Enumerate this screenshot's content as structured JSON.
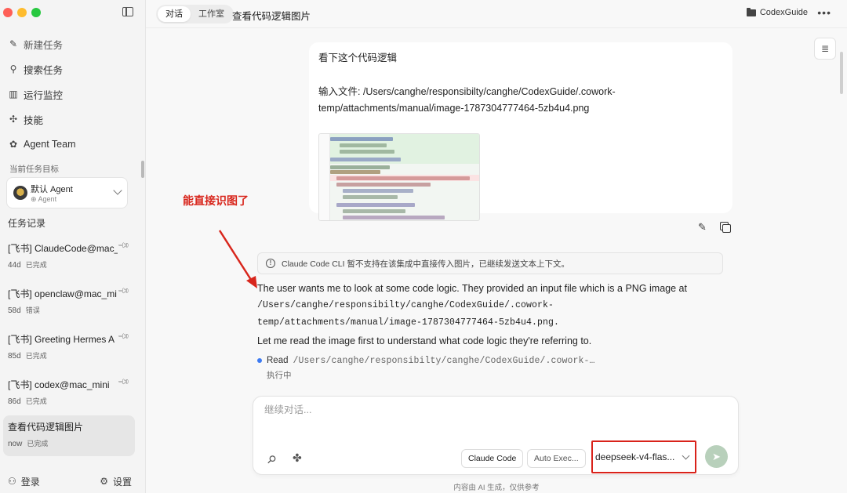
{
  "sidebar": {
    "nav": [
      {
        "label": "新建任务",
        "icon": "new-task-icon"
      },
      {
        "label": "搜索任务",
        "icon": "search-icon"
      },
      {
        "label": "运行监控",
        "icon": "bar-chart-icon"
      },
      {
        "label": "技能",
        "icon": "puzzle-icon"
      },
      {
        "label": "Agent Team",
        "icon": "team-icon"
      }
    ],
    "current_goal_label": "当前任务目标",
    "agent": {
      "name": "默认 Agent",
      "sub": "Agent"
    },
    "tasks_label": "任务记录",
    "tasks": [
      {
        "title": "[飞书] ClaudeCode@mac_",
        "age": "44d",
        "status": "已完成",
        "pinned": true
      },
      {
        "title": "[飞书] openclaw@mac_mi",
        "age": "58d",
        "status": "错误",
        "pinned": true
      },
      {
        "title": "[飞书] Greeting Hermes A",
        "age": "85d",
        "status": "已完成",
        "pinned": true
      },
      {
        "title": "[飞书] codex@mac_mini",
        "age": "86d",
        "status": "已完成",
        "pinned": true
      },
      {
        "title": "查看代码逻辑图片",
        "age": "now",
        "status": "已完成",
        "pinned": false
      }
    ],
    "footer": {
      "login": "登录",
      "settings": "设置"
    }
  },
  "topbar": {
    "tabs": [
      "对话",
      "工作室"
    ],
    "active_tab": "对话",
    "title": "查看代码逻辑图片",
    "project": "CodexGuide",
    "more": "•••"
  },
  "conversation": {
    "user_message": {
      "line1": "看下这个代码逻辑",
      "line2": "输入文件: /Users/canghe/responsibilty/canghe/CodexGuide/.cowork-temp/attachments/manual/image-1787304777464-5zb4u4.png"
    },
    "annotation": "能直接识图了",
    "notice": "Claude Code CLI 暂不支持在该集成中直接传入图片，已继续发送文本上下文。",
    "assistant": {
      "p1_text": "The user wants me to look at some code logic. They provided an input file which is a PNG image at",
      "p1_path": "/Users/canghe/responsibilty/canghe/CodexGuide/.cowork-temp/attachments/manual/image-1787304777464-5zb4u4.png.",
      "p2": "Let me read the image first to understand what code logic they're referring to."
    },
    "tool": {
      "name": "Read",
      "path": "/Users/canghe/responsibilty/canghe/CodexGuide/.cowork-…",
      "status": "执行中"
    }
  },
  "composer": {
    "placeholder": "继续对话...",
    "chip_claude": "Claude Code",
    "chip_auto": "Auto Exec...",
    "model": "deepseek-v4-flas...",
    "send": "➤"
  },
  "footer_note": "内容由 AI 生成，仅供参考",
  "colors": {
    "annotation_red": "#d8261c",
    "send_green": "#b8d0bb",
    "tool_dot_blue": "#3d7bf2"
  }
}
